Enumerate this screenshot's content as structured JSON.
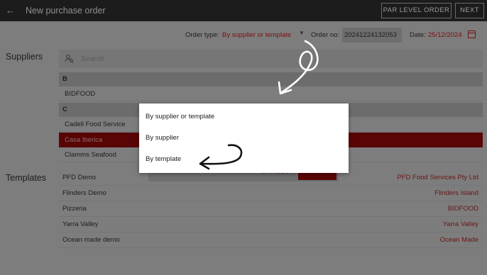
{
  "header": {
    "title": "New purchase order",
    "par_level_label": "PAR LEVEL ORDER",
    "next_label": "NEXT"
  },
  "order": {
    "type_label": "Order type:",
    "type_value": "By supplier or template",
    "no_label": "Order no:",
    "no_value": "20241224132053",
    "date_label": "Date:",
    "date_value": "25/12/2024"
  },
  "suppliers": {
    "heading": "Suppliers",
    "search_placeholder": "Search",
    "groups": [
      {
        "letter": "B",
        "items": [
          "BIDFOOD"
        ]
      },
      {
        "letter": "C",
        "items": [
          "Cadell Food Service",
          "Casa Iberica",
          "Clamms Seafood"
        ]
      }
    ],
    "selected": "Casa Iberica"
  },
  "templates": {
    "heading": "Templates",
    "rows": [
      {
        "name": "PFD Demo",
        "supplier": "PFD Food Services Pty Ltd"
      },
      {
        "name": "Flinders Demo",
        "supplier": "Flinders Island"
      },
      {
        "name": "Pizzeria",
        "supplier": "BIDFOOD"
      },
      {
        "name": "Yarra Valley",
        "supplier": "Yarra Valley"
      },
      {
        "name": "Ocean made demo",
        "supplier": "Ocean Made"
      }
    ]
  },
  "dialog": {
    "cancel_label": "CANCEL"
  },
  "menu": {
    "options": [
      "By supplier or template",
      "By supplier",
      "By template"
    ]
  },
  "colors": {
    "accent": "#7b1010",
    "topbar": "#1c1c1c",
    "overlay_bg": "#7d7d7d",
    "menu_bg": "#ffffff"
  }
}
